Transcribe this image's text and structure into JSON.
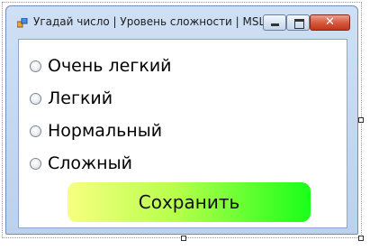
{
  "window": {
    "title": "Угадай число | Уровень сложности | MSL",
    "controls": {
      "minimize": "minimize",
      "maximize": "maximize",
      "close": "✕"
    }
  },
  "difficulty": {
    "options": [
      {
        "label": "Очень легкий",
        "selected": false
      },
      {
        "label": "Легкий",
        "selected": false
      },
      {
        "label": "Нормальный",
        "selected": false
      },
      {
        "label": "Сложный",
        "selected": false
      }
    ]
  },
  "save_button": {
    "label": "Сохранить"
  },
  "colors": {
    "save_gradient_start": "#f7ff80",
    "save_gradient_end": "#19ff19",
    "title_bar": "#cfe0f5",
    "close_button": "#d75a3f"
  }
}
